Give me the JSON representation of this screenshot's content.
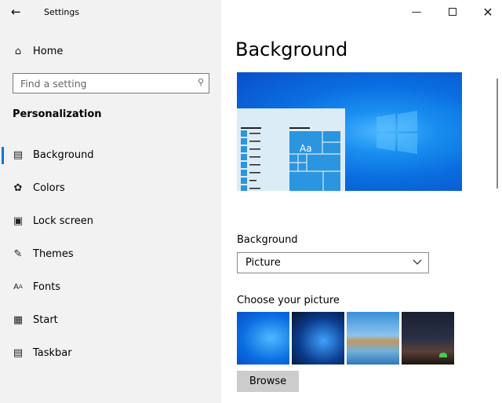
{
  "window": {
    "title": "Settings",
    "back_icon": "arrow-left-icon"
  },
  "sidebar": {
    "home": "Home",
    "search_placeholder": "Find a setting",
    "section": "Personalization",
    "items": [
      {
        "label": "Background",
        "icon": "picture-icon",
        "active": true
      },
      {
        "label": "Colors",
        "icon": "palette-icon"
      },
      {
        "label": "Lock screen",
        "icon": "lock-screen-icon"
      },
      {
        "label": "Themes",
        "icon": "themes-icon"
      },
      {
        "label": "Fonts",
        "icon": "fonts-icon"
      },
      {
        "label": "Start",
        "icon": "start-icon"
      },
      {
        "label": "Taskbar",
        "icon": "taskbar-icon"
      }
    ]
  },
  "main": {
    "title": "Background",
    "preview_tile_label": "Aa",
    "background_label": "Background",
    "background_value": "Picture",
    "choose_label": "Choose your picture",
    "browse": "Browse"
  },
  "colors": {
    "accent": "#0078d7",
    "sidebar_bg": "#f2f2f2"
  }
}
